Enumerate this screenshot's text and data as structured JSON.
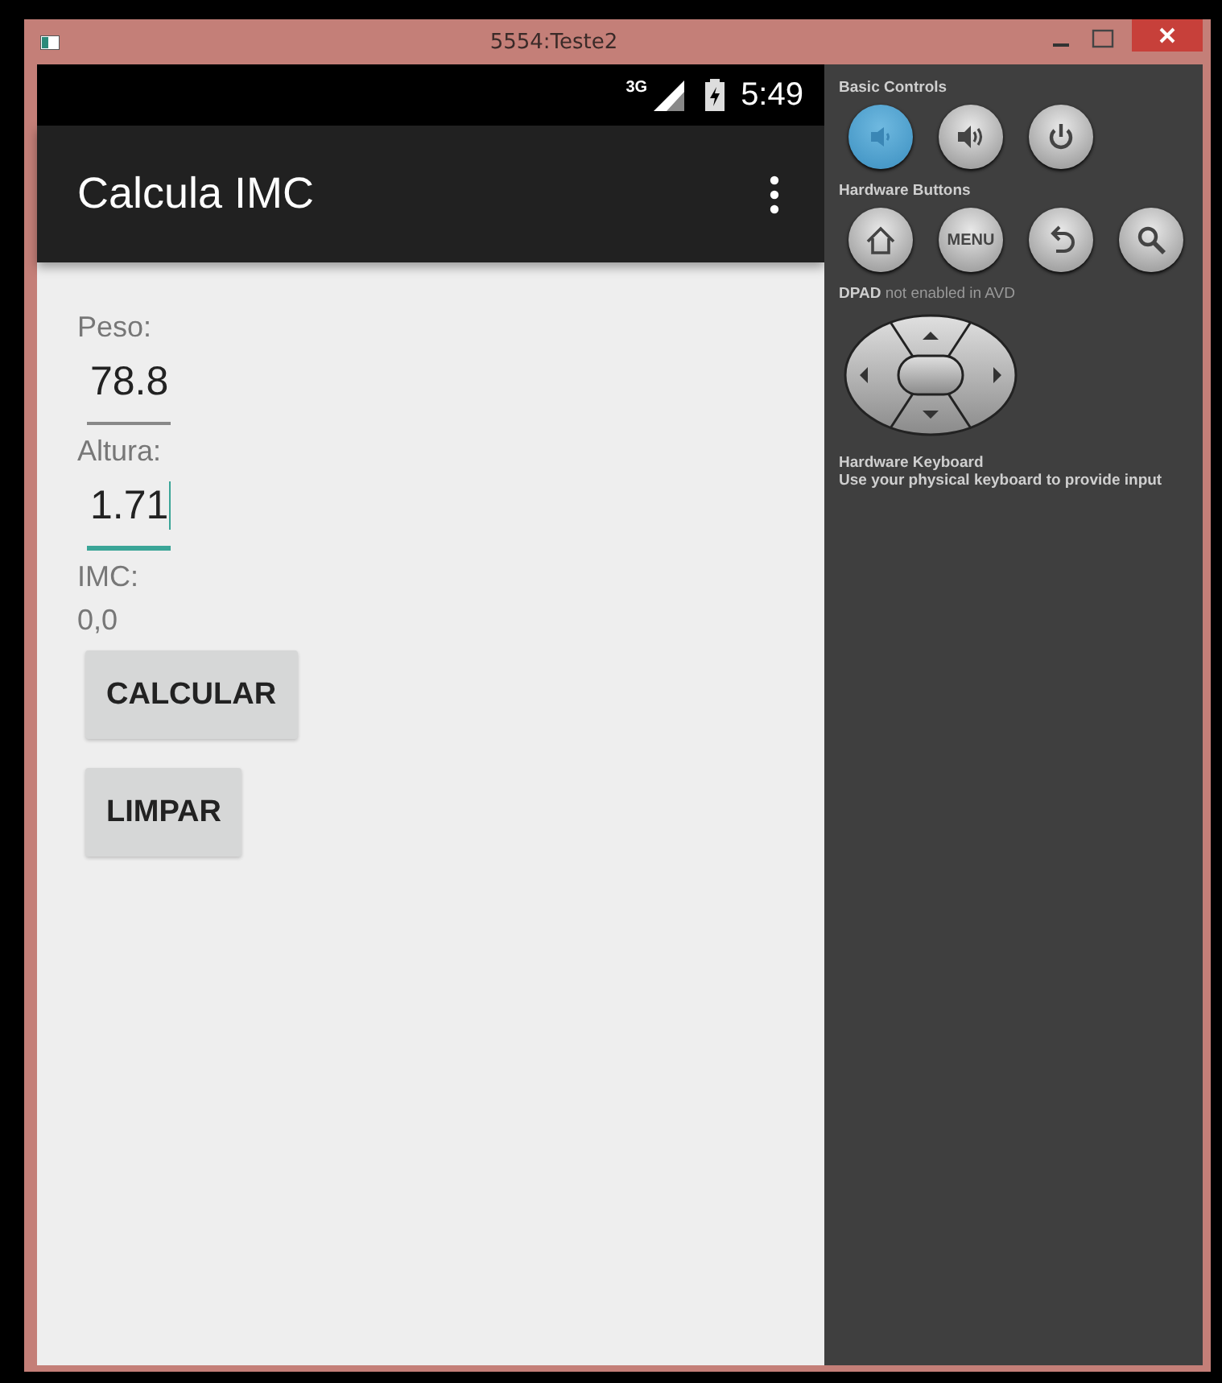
{
  "window": {
    "title": "5554:Teste2"
  },
  "status_bar": {
    "network": "3G",
    "time": "5:49"
  },
  "app_bar": {
    "title": "Calcula IMC"
  },
  "form": {
    "fields": [
      {
        "label": "Peso:",
        "value": "78.8",
        "focused": false
      },
      {
        "label": "Altura:",
        "value": "1.71",
        "focused": true
      }
    ],
    "result": {
      "label": "IMC:",
      "value": "0,0"
    },
    "buttons": [
      "CALCULAR",
      "LIMPAR"
    ]
  },
  "controls_panel": {
    "sections": [
      {
        "title": "Basic Controls",
        "buttons": [
          {
            "kind": "volume-down",
            "active": true
          },
          {
            "kind": "volume-up",
            "active": false
          },
          {
            "kind": "power",
            "active": false
          }
        ]
      },
      {
        "title": "Hardware Buttons",
        "buttons": [
          {
            "kind": "home",
            "active": false
          },
          {
            "kind": "menu",
            "label": "MENU",
            "active": false
          },
          {
            "kind": "back",
            "active": false
          },
          {
            "kind": "search",
            "active": false
          }
        ]
      }
    ],
    "dpad_note": "**DPAD** not enabled in AVD",
    "keyboard": {
      "title": "Hardware Keyboard",
      "text": "Use your physical keyboard to provide input"
    }
  }
}
